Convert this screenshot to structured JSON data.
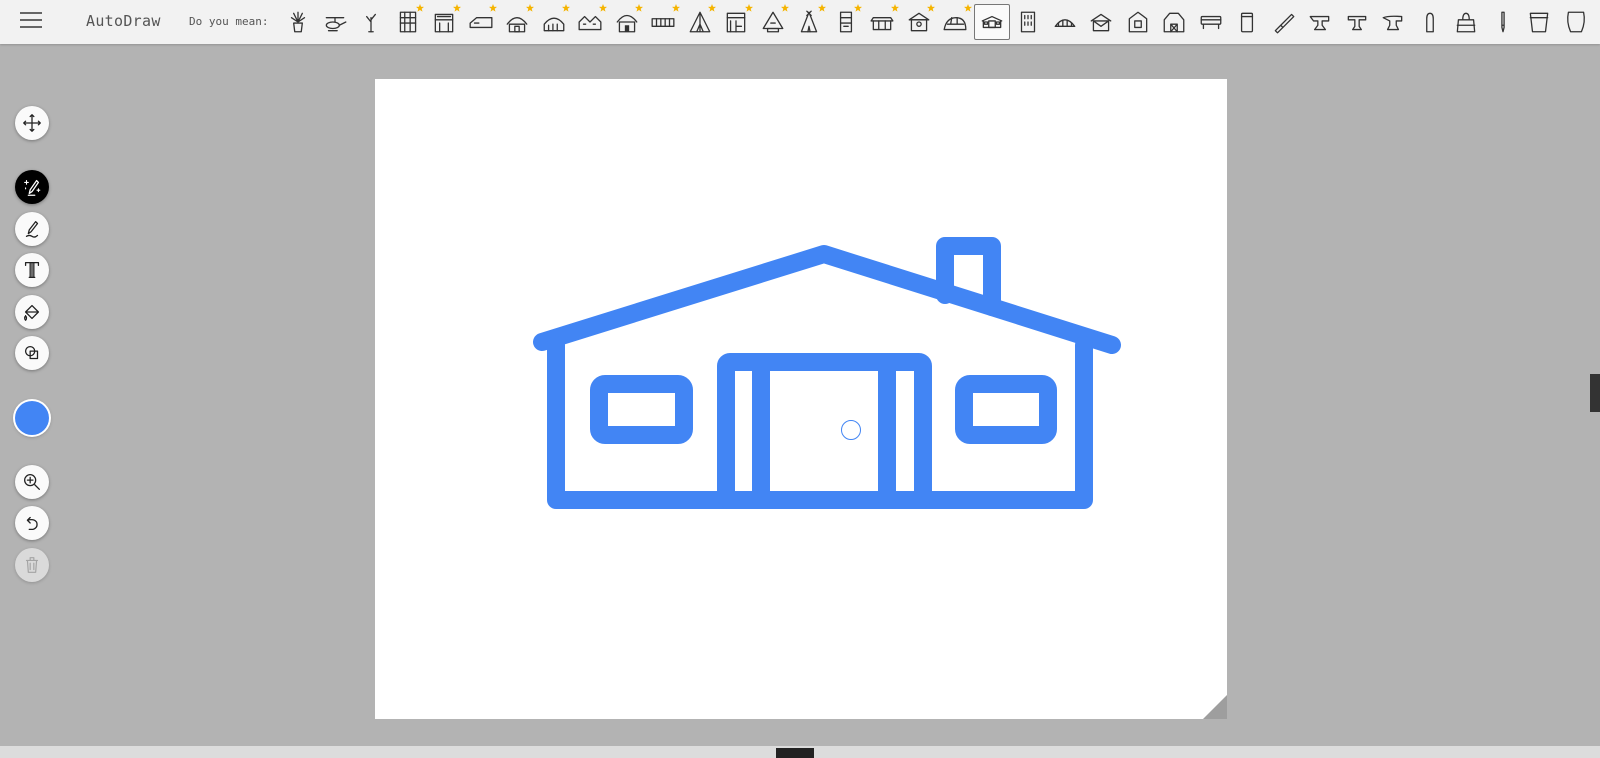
{
  "app": {
    "title": "AutoDraw"
  },
  "suggestions_bar": {
    "label": "Do you mean:",
    "items": [
      {
        "name": "potted-plant-icon",
        "featured": false,
        "selected": false
      },
      {
        "name": "helicopter-icon",
        "featured": false,
        "selected": false
      },
      {
        "name": "plant-sprout-icon",
        "featured": false,
        "selected": false
      },
      {
        "name": "building-grid-icon",
        "featured": true,
        "selected": false
      },
      {
        "name": "storefront-icon",
        "featured": true,
        "selected": false
      },
      {
        "name": "long-house-icon",
        "featured": true,
        "selected": false
      },
      {
        "name": "hut-icon",
        "featured": true,
        "selected": false
      },
      {
        "name": "quonset-hut-icon",
        "featured": true,
        "selected": false
      },
      {
        "name": "row-houses-icon",
        "featured": true,
        "selected": false
      },
      {
        "name": "cottage-icon",
        "featured": true,
        "selected": false
      },
      {
        "name": "fence-icon",
        "featured": true,
        "selected": false
      },
      {
        "name": "tent-icon",
        "featured": true,
        "selected": false
      },
      {
        "name": "shop-icon",
        "featured": true,
        "selected": false
      },
      {
        "name": "pyramid-house-icon",
        "featured": true,
        "selected": false
      },
      {
        "name": "teepee-icon",
        "featured": true,
        "selected": false
      },
      {
        "name": "tower-icon",
        "featured": true,
        "selected": false
      },
      {
        "name": "stable-icon",
        "featured": true,
        "selected": false
      },
      {
        "name": "pavilion-icon",
        "featured": true,
        "selected": false
      },
      {
        "name": "igloo-icon",
        "featured": true,
        "selected": false
      },
      {
        "name": "ranch-house-icon",
        "featured": false,
        "selected": true
      },
      {
        "name": "tall-building-icon",
        "featured": false,
        "selected": false
      },
      {
        "name": "dome-house-icon",
        "featured": false,
        "selected": false
      },
      {
        "name": "envelope-icon",
        "featured": false,
        "selected": false
      },
      {
        "name": "house-window-icon",
        "featured": false,
        "selected": false
      },
      {
        "name": "barn-icon",
        "featured": false,
        "selected": false
      },
      {
        "name": "bench-icon",
        "featured": false,
        "selected": false
      },
      {
        "name": "trash-bin-icon",
        "featured": false,
        "selected": false
      },
      {
        "name": "brush-icon",
        "featured": false,
        "selected": false
      },
      {
        "name": "anvil-icon",
        "featured": false,
        "selected": false
      },
      {
        "name": "t-anvil-icon",
        "featured": false,
        "selected": false
      },
      {
        "name": "anvil-heavy-icon",
        "featured": false,
        "selected": false
      },
      {
        "name": "thumb-icon",
        "featured": false,
        "selected": false
      },
      {
        "name": "handbag-icon",
        "featured": false,
        "selected": false
      },
      {
        "name": "pencil-thin-icon",
        "featured": false,
        "selected": false
      },
      {
        "name": "bucket-icon",
        "featured": false,
        "selected": false
      },
      {
        "name": "paper-cup-icon",
        "featured": false,
        "selected": false
      }
    ]
  },
  "toolbar": {
    "tools": [
      {
        "name": "move-tool",
        "icon": "move-icon",
        "active": false,
        "disabled": false
      },
      {
        "name": "autodraw-tool",
        "icon": "autodraw-sparkle-pencil-icon",
        "active": true,
        "disabled": false
      },
      {
        "name": "draw-tool",
        "icon": "pencil-icon",
        "active": false,
        "disabled": false
      },
      {
        "name": "type-tool",
        "icon": "text-icon",
        "active": false,
        "disabled": false
      },
      {
        "name": "fill-tool",
        "icon": "paint-bucket-icon",
        "active": false,
        "disabled": false
      },
      {
        "name": "shape-tool",
        "icon": "shapes-icon",
        "active": false,
        "disabled": false
      },
      {
        "name": "color-picker",
        "icon": "color-swatch",
        "active": false,
        "disabled": false
      },
      {
        "name": "zoom-tool",
        "icon": "zoom-in-icon",
        "active": false,
        "disabled": false
      },
      {
        "name": "undo-button",
        "icon": "undo-icon",
        "active": false,
        "disabled": false
      },
      {
        "name": "delete-button",
        "icon": "trash-icon",
        "active": false,
        "disabled": true
      }
    ]
  },
  "colors": {
    "stroke": "#4285f4",
    "selected_color": "#4285f4",
    "star": "#f5b400",
    "active_tool_bg": "#000000"
  }
}
